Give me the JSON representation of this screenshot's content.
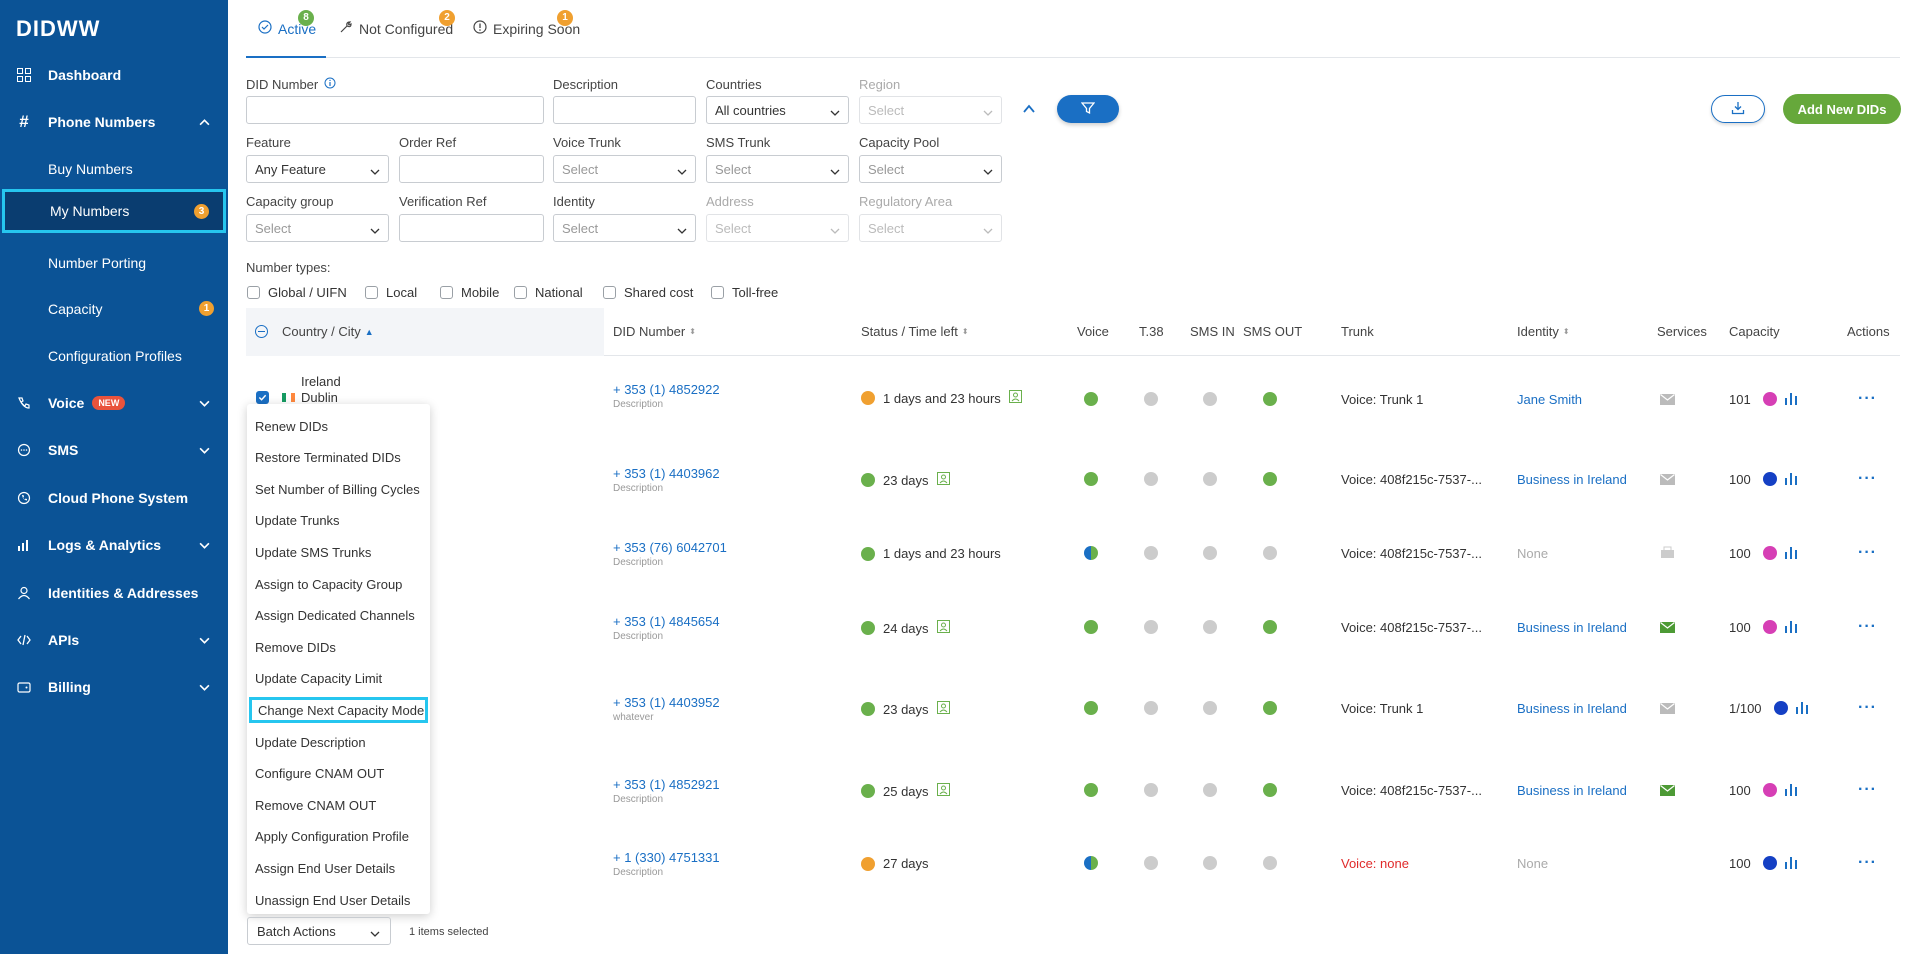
{
  "brand": "DIDWW",
  "sidebar": {
    "items": [
      {
        "label": "Dashboard",
        "icon": "grid-icon"
      },
      {
        "label": "Phone Numbers",
        "icon": "hash-icon"
      },
      {
        "label": "Buy Numbers"
      },
      {
        "label": "My Numbers",
        "badge": "3"
      },
      {
        "label": "Number Porting"
      },
      {
        "label": "Capacity",
        "badge": "1"
      },
      {
        "label": "Configuration Profiles"
      },
      {
        "label": "Voice",
        "icon": "phone-icon",
        "tag": "NEW"
      },
      {
        "label": "SMS",
        "icon": "chat-icon"
      },
      {
        "label": "Cloud Phone System",
        "icon": "cloud-phone-icon"
      },
      {
        "label": "Logs & Analytics",
        "icon": "bar-chart-icon"
      },
      {
        "label": "Identities & Addresses",
        "icon": "person-icon"
      },
      {
        "label": "APIs",
        "icon": "code-icon"
      },
      {
        "label": "Billing",
        "icon": "wallet-icon"
      }
    ]
  },
  "tabs": [
    {
      "label": "Active",
      "count": "8",
      "color": "#6ab04c"
    },
    {
      "label": "Not Configured",
      "count": "2",
      "color": "#f0a030"
    },
    {
      "label": "Expiring Soon",
      "count": "1",
      "color": "#f0a030"
    }
  ],
  "filters": {
    "did_number": "DID Number",
    "description": "Description",
    "countries": "Countries",
    "countries_value": "All countries",
    "region": "Region",
    "feature": "Feature",
    "feature_value": "Any Feature",
    "order_ref": "Order Ref",
    "voice_trunk": "Voice Trunk",
    "sms_trunk": "SMS Trunk",
    "capacity_pool": "Capacity Pool",
    "capacity_group": "Capacity group",
    "verification_ref": "Verification Ref",
    "identity": "Identity",
    "address": "Address",
    "regulatory_area": "Regulatory Area",
    "select_placeholder": "Select"
  },
  "buttons": {
    "add": "Add New DIDs"
  },
  "number_types": {
    "label": "Number types:",
    "options": [
      "Global / UIFN",
      "Local",
      "Mobile",
      "National",
      "Shared cost",
      "Toll-free"
    ]
  },
  "table": {
    "headers": [
      "Country / City",
      "DID Number",
      "Status / Time left",
      "Voice",
      "T.38",
      "SMS IN",
      "SMS OUT",
      "Trunk",
      "Identity",
      "Services",
      "Capacity",
      "Actions"
    ],
    "first_row": {
      "country": "Ireland",
      "city": "Dublin"
    },
    "rows": [
      {
        "did": "+ 353 (1) 4852922",
        "desc": "Description",
        "status": "1 days and 23 hours",
        "status_color": "orange",
        "trunk": "Voice: Trunk 1",
        "identity": "Jane Smith",
        "capacity": "101",
        "cap_color": "pink"
      },
      {
        "did": "+ 353 (1) 4403962",
        "desc": "Description",
        "status": "23 days",
        "status_color": "green",
        "trunk": "Voice: 408f215c-7537-...",
        "identity": "Business in Ireland",
        "capacity": "100",
        "cap_color": "blue"
      },
      {
        "did": "+ 353 (76) 6042701",
        "desc": "Description",
        "status": "1 days and 23 hours",
        "status_color": "green",
        "trunk": "Voice: 408f215c-7537-...",
        "identity": "None",
        "capacity": "100",
        "cap_color": "pink"
      },
      {
        "did": "+ 353 (1) 4845654",
        "desc": "Description",
        "status": "24 days",
        "status_color": "green",
        "trunk": "Voice: 408f215c-7537-...",
        "identity": "Business in Ireland",
        "capacity": "100",
        "cap_color": "pink"
      },
      {
        "did": "+ 353 (1) 4403952",
        "desc": "whatever",
        "status": "23 days",
        "status_color": "green",
        "trunk": "Voice: Trunk 1",
        "identity": "Business in Ireland",
        "capacity": "1/100",
        "cap_color": "blue"
      },
      {
        "did": "+ 353 (1) 4852921",
        "desc": "Description",
        "status": "25 days",
        "status_color": "green",
        "trunk": "Voice: 408f215c-7537-...",
        "identity": "Business in Ireland",
        "capacity": "100",
        "cap_color": "pink"
      },
      {
        "did": "+ 1 (330) 4751331",
        "desc": "Description",
        "status": "27 days",
        "status_color": "orange",
        "trunk": "Voice: none",
        "identity": "None",
        "capacity": "100",
        "cap_color": "blue"
      }
    ]
  },
  "batch_menu": {
    "items": [
      "Renew DIDs",
      "Restore Terminated DIDs",
      "Set Number of Billing Cycles",
      "Update Trunks",
      "Update SMS Trunks",
      "Assign to Capacity Group",
      "Assign Dedicated Channels",
      "Remove DIDs",
      "Update Capacity Limit",
      "Change Next Capacity Mode",
      "Update Description",
      "Configure CNAM OUT",
      "Remove CNAM OUT",
      "Apply Configuration Profile",
      "Assign End User Details",
      "Unassign End User Details"
    ],
    "highlighted": "Change Next Capacity Mode"
  },
  "footer": {
    "batch_label": "Batch Actions",
    "selected_text": "1 items selected"
  }
}
